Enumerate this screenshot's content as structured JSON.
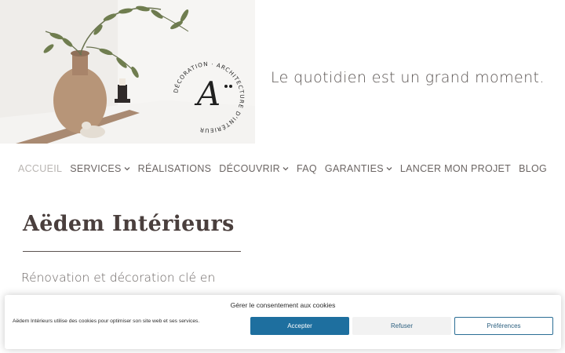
{
  "hero": {
    "tagline": "Le quotidien est un grand moment.",
    "logo": {
      "monogram": "A",
      "arc_text": "DÉCORATION · ARCHITECTURE D'INTÉRIEUR"
    }
  },
  "nav": {
    "items": [
      {
        "label": "ACCUEIL",
        "active": true,
        "has_dropdown": false
      },
      {
        "label": "SERVICES",
        "active": false,
        "has_dropdown": true
      },
      {
        "label": "RÉALISATIONS",
        "active": false,
        "has_dropdown": false
      },
      {
        "label": "DÉCOUVRIR",
        "active": false,
        "has_dropdown": true
      },
      {
        "label": "FAQ",
        "active": false,
        "has_dropdown": false
      },
      {
        "label": "GARANTIES",
        "active": false,
        "has_dropdown": true
      },
      {
        "label": "LANCER MON PROJET",
        "active": false,
        "has_dropdown": false
      },
      {
        "label": "BLOG",
        "active": false,
        "has_dropdown": false
      }
    ]
  },
  "main": {
    "title": "Aëdem Intérieurs",
    "subtitle": "Rénovation et décoration clé en"
  },
  "cookie": {
    "title": "Gérer le consentement aux cookies",
    "text": "Aëdem Intérieurs utilise des cookies pour optimiser son site web et ses services.",
    "accept_label": "Accepter",
    "refuse_label": "Refuser",
    "prefs_label": "Préférences"
  },
  "colors": {
    "accent": "#1e6f9f",
    "nav_active": "#b9b5b2",
    "text": "#6b6563"
  }
}
